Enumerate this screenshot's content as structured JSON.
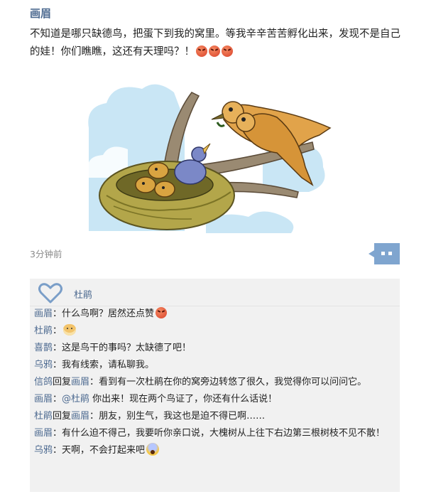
{
  "post": {
    "author": "画眉",
    "text": "不知道是哪只缺德鸟，把蛋下到我的窝里。等我辛辛苦苦孵化出来，发现不是自己的娃！你们瞧瞧，这还有天理吗？！",
    "text_emojis": [
      "angry-face-icon",
      "angry-face-icon",
      "angry-face-icon"
    ],
    "time": "3分钟前"
  },
  "likes": {
    "names": "杜鹃"
  },
  "comments": [
    {
      "name": "画眉",
      "sep": "：",
      "text": "什么鸟啊？居然还点赞",
      "emoji": "angry"
    },
    {
      "name": "杜鹃",
      "sep": "：",
      "text": "",
      "emoji": "dog"
    },
    {
      "name": "喜鹊",
      "sep": "：",
      "text": "这是鸟干的事吗？太缺德了吧！"
    },
    {
      "name": "乌鸦",
      "sep": "：",
      "text": "我有线索，请私聊我。"
    },
    {
      "name": "信鸽",
      "reply_word": "回复",
      "reply_to": "画眉",
      "sep": "：",
      "text": "看到有一次杜鹃在你的窝旁边转悠了很久，我觉得你可以问问它。"
    },
    {
      "name": "画眉",
      "sep": "：",
      "mention": "@杜鹃",
      "text": " 你出来！现在两个鸟证了，你还有什么话说！"
    },
    {
      "name": "杜鹃",
      "reply_word": "回复",
      "reply_to": "画眉",
      "sep": "：",
      "text": "朋友，别生气，我这也是迫不得已啊……"
    },
    {
      "name": "画眉",
      "sep": "：",
      "text": "有什么迫不得己，我要听你亲口说，大槐树从上往下右边第三根树枝不见不散！"
    },
    {
      "name": "乌鸦",
      "sep": "：",
      "text": "天啊，不会打起来吧",
      "emoji": "scream"
    }
  ],
  "colors": {
    "name_blue": "#4e6b91",
    "comment_bg": "#f1f1f1",
    "button_blue": "#7fa5cf"
  }
}
